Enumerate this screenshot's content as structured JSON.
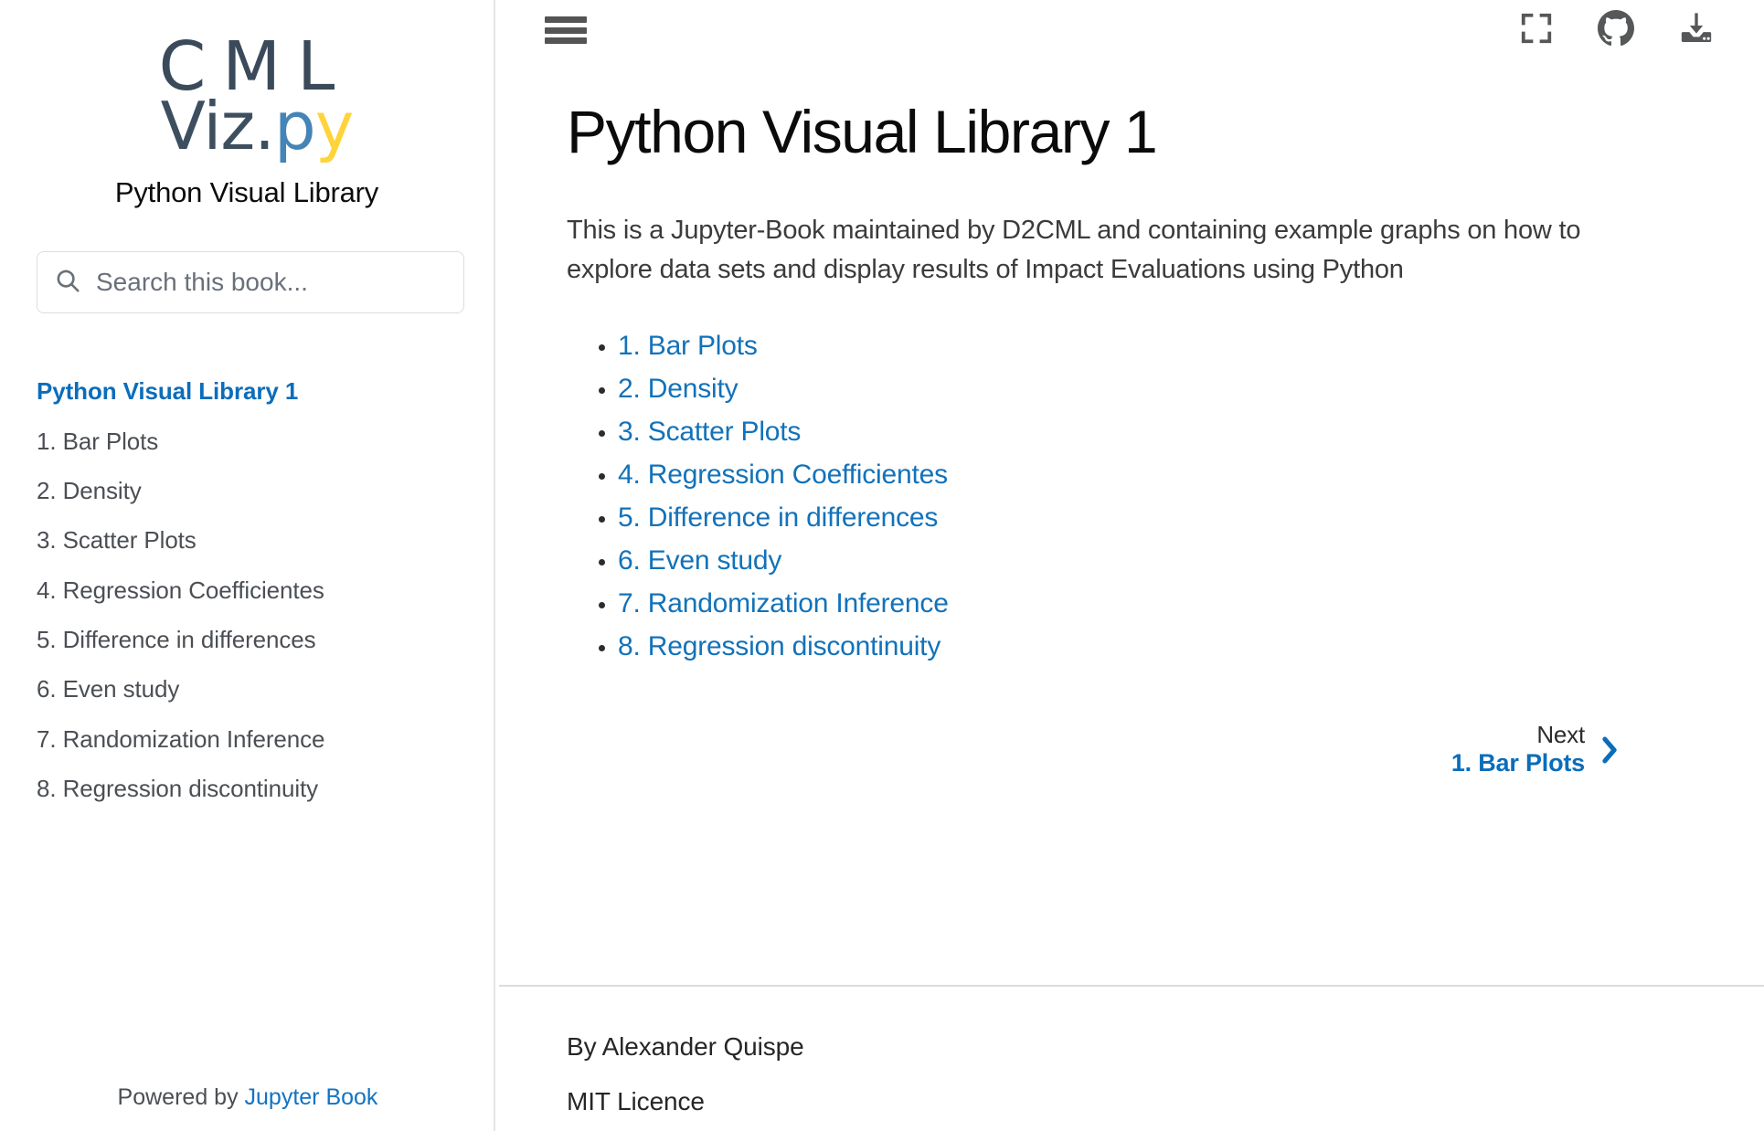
{
  "sidebar": {
    "logo": {
      "line1": "CML",
      "line2_prefix": "Viz",
      "line2_dot": ".",
      "line2_p": "p",
      "line2_y": "y",
      "colors": {
        "slate": "#3a4a5a",
        "python_blue": "#4584b6",
        "python_yellow": "#ffd43b"
      }
    },
    "subtitle": "Python Visual Library",
    "search": {
      "placeholder": "Search this book...",
      "value": "",
      "icon": "search-icon"
    },
    "toc": [
      {
        "label": "Python Visual Library 1",
        "current": true
      },
      {
        "label": "1. Bar Plots",
        "current": false
      },
      {
        "label": "2. Density",
        "current": false
      },
      {
        "label": "3. Scatter Plots",
        "current": false
      },
      {
        "label": "4. Regression Coefficientes",
        "current": false
      },
      {
        "label": "5. Difference in differences",
        "current": false
      },
      {
        "label": "6. Even study",
        "current": false
      },
      {
        "label": "7. Randomization Inference",
        "current": false
      },
      {
        "label": "8. Regression discontinuity",
        "current": false
      }
    ],
    "footer": {
      "powered_by": "Powered by ",
      "link_label": "Jupyter Book"
    }
  },
  "topbar": {
    "menu_icon": "hamburger-menu-icon",
    "fullscreen_icon": "fullscreen-icon",
    "github_icon": "github-icon",
    "download_icon": "download-icon"
  },
  "main": {
    "title": "Python Visual Library 1",
    "intro": "This is a Jupyter-Book maintained by D2CML and containing example graphs on how to explore data sets and display results of Impact Evaluations using Python",
    "chapters": [
      "1. Bar Plots",
      "2. Density",
      "3. Scatter Plots",
      "4. Regression Coefficientes",
      "5. Difference in differences",
      "6. Even study",
      "7. Randomization Inference",
      "8. Regression discontinuity"
    ],
    "nav": {
      "next_label": "Next",
      "next_title": "1. Bar Plots",
      "chevron_icon": "chevron-right-icon"
    },
    "footer": {
      "author": "By Alexander Quispe",
      "licence": "MIT Licence"
    }
  },
  "theme": {
    "link_blue": "#1272ba",
    "active_blue": "#0b6dba",
    "text_gray": "#4b4f54",
    "border_gray": "#e6e6e6"
  }
}
